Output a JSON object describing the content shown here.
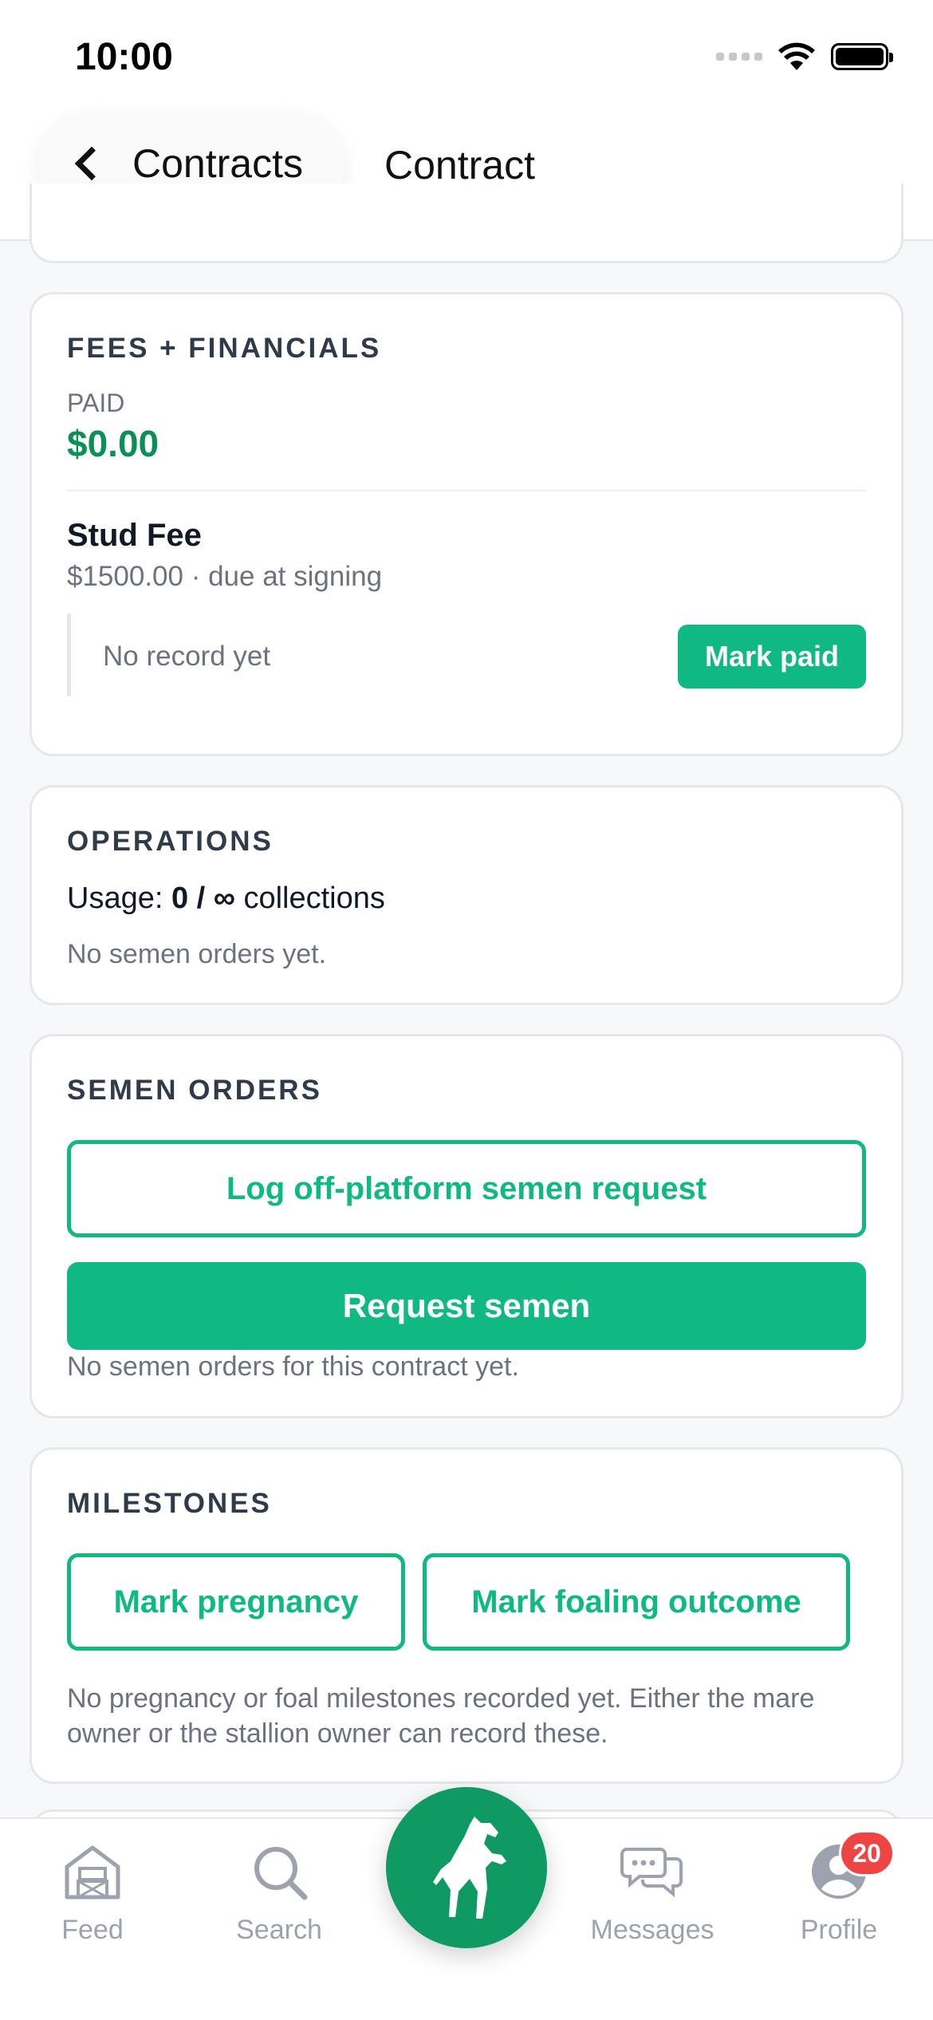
{
  "status_bar": {
    "time": "10:00"
  },
  "nav": {
    "back_label": "Contracts",
    "title": "Contract"
  },
  "fees": {
    "section_title": "FEES + FINANCIALS",
    "paid_label": "PAID",
    "paid_value": "$0.00",
    "fee_name": "Stud Fee",
    "fee_detail": "$1500.00 · due at signing",
    "record_text": "No record yet",
    "mark_paid_label": "Mark paid"
  },
  "operations": {
    "section_title": "OPERATIONS",
    "usage_prefix": "Usage:",
    "usage_value": "0 / ∞",
    "usage_suffix": "collections",
    "note": "No semen orders yet."
  },
  "semen_orders": {
    "section_title": "SEMEN ORDERS",
    "log_button_label": "Log off-platform semen request",
    "request_button_label": "Request semen",
    "note": "No semen orders for this contract yet."
  },
  "milestones": {
    "section_title": "MILESTONES",
    "pregnancy_button_label": "Mark pregnancy",
    "foaling_button_label": "Mark foaling outcome",
    "note": "No pregnancy or foal milestones recorded yet. Either the mare owner or the stallion owner can record these."
  },
  "tab_bar": {
    "feed_label": "Feed",
    "search_label": "Search",
    "messages_label": "Messages",
    "profile_label": "Profile",
    "profile_badge": "20"
  },
  "colors": {
    "accent": "#10b981",
    "accent_dark": "#0f9a63",
    "paid_green": "#0b8f57",
    "badge_red": "#ef4444"
  }
}
